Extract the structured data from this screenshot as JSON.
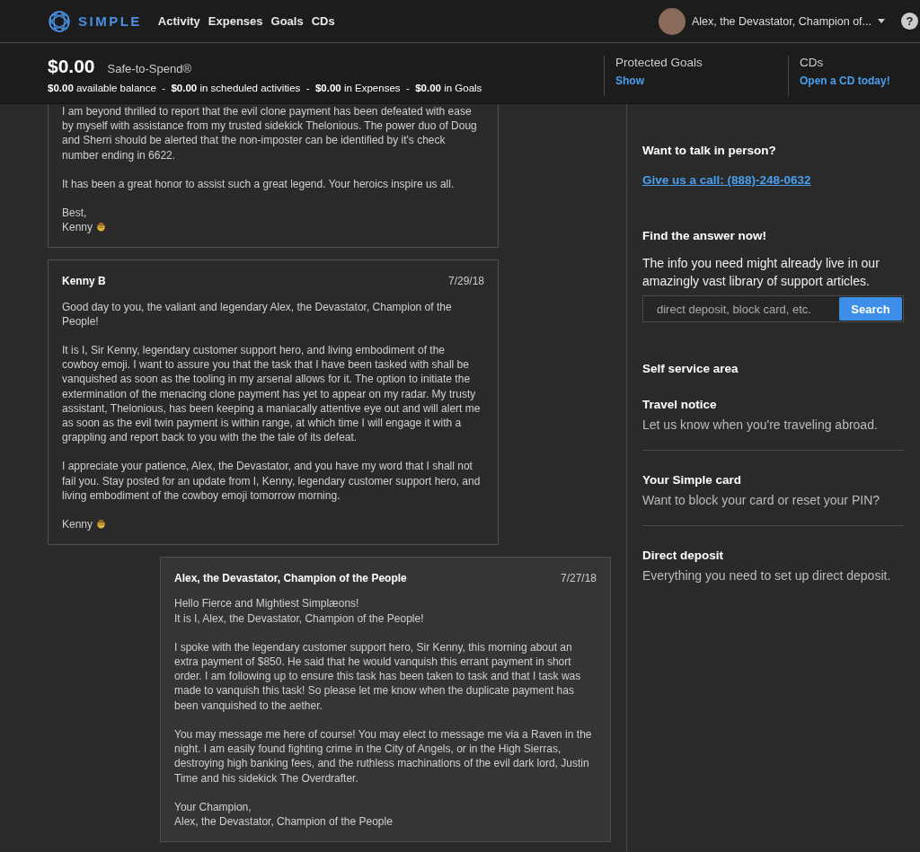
{
  "nav": {
    "brand": "SIMPLE",
    "links": [
      "Activity",
      "Expenses",
      "Goals",
      "CDs"
    ],
    "user_name": "Alex, the Devastator, Champion of...",
    "help": "?"
  },
  "summary": {
    "amount": "$0.00",
    "amount_label": "Safe-to-Spend®",
    "breakdown": "**$0.00** available balance  -  **$0.00** in scheduled activities  -  **$0.00** in Expenses  -  **$0.00** in Goals",
    "panels": [
      {
        "title": "Protected Goals",
        "link": "Show"
      },
      {
        "title": "CDs",
        "link": "Open a CD today!"
      }
    ]
  },
  "messages": [
    {
      "kind": "support",
      "cut_top": true,
      "paragraphs": [
        "I am beyond thrilled to report that the evil clone payment has been defeated with ease by myself with assistance from my trusted sidekick Thelonious. The power duo of Doug and Sherri should be alerted that the non-imposter can be identified by it's check number ending in 6622.",
        "It has been a great honor to assist such a great legend. Your heroics inspire us all.",
        "Best,\nKenny"
      ],
      "emoji_signature": true
    },
    {
      "kind": "support",
      "cut_top": false,
      "author": "Kenny B",
      "date": "7/29/18",
      "paragraphs": [
        "Good day to you, the valiant and legendary Alex, the Devastator, Champion of the People!",
        "It is I, Sir Kenny, legendary customer support hero, and living embodiment of the cowboy emoji. I want to assure you that the task that I have been tasked with shall be vanquished as soon as the tooling in my arsenal allows for it. The option to initiate the extermination of the menacing clone payment has yet to appear on my radar. My trusty assistant, Thelonious, has been keeping a maniacally attentive eye out and will alert me as soon as the evil twin payment is within range, at which time I will engage it with a grappling and report back to you with the the tale of its defeat.",
        "I appreciate your patience, Alex, the Devastator, and you have my word that I shall not fail you. Stay posted for an update from I, Kenny, legendary customer support hero, and living embodiment of the cowboy emoji tomorrow morning.",
        "Kenny"
      ],
      "emoji_signature": true
    },
    {
      "kind": "customer",
      "cut_top": false,
      "author": "Alex, the Devastator, Champion of the People",
      "date": "7/27/18",
      "paragraphs": [
        "Hello Fierce and Mightiest Simplæons!\nIt is I, Alex, the Devastator, Champion of the People!",
        "I spoke with the legendary customer support hero, Sir Kenny, this morning about an extra payment of $850. He said that he would vanquish this errant payment in short order. I am following up to ensure this task has been taken to task and that I task was made to vanquish this task! So please let me know when the duplicate payment has been vanquished to the aether.",
        "You may message me here of course! You may elect to message me via a Raven in the night. I am easily found fighting crime in the City of Angels, or in the High Sierras, destroying high banking fees, and the ruthless machinations of the evil dark lord, Justin Time and his sidekick The Overdrafter.",
        "Your Champion,\nAlex, the Devastator, Champion of the People"
      ],
      "emoji_signature": false
    }
  ],
  "sidebar": {
    "contact_heading": "Want to talk in person?",
    "contact_link": "Give us a call: (888)-248-0632",
    "search_heading": "Find the answer now!",
    "search_text": "The info you need might already live in our amazingly vast library of support articles.",
    "search": {
      "placeholder": "direct deposit, block card, etc.",
      "button": "Search"
    },
    "self_service_heading": "Self service area",
    "items": [
      {
        "title": "Travel notice",
        "text": "Let us know when you're traveling abroad."
      },
      {
        "title": "Your Simple card",
        "text": "Want to block your card or reset your PIN?"
      },
      {
        "title": "Direct deposit",
        "text": "Everything you need to set up direct deposit."
      }
    ]
  }
}
